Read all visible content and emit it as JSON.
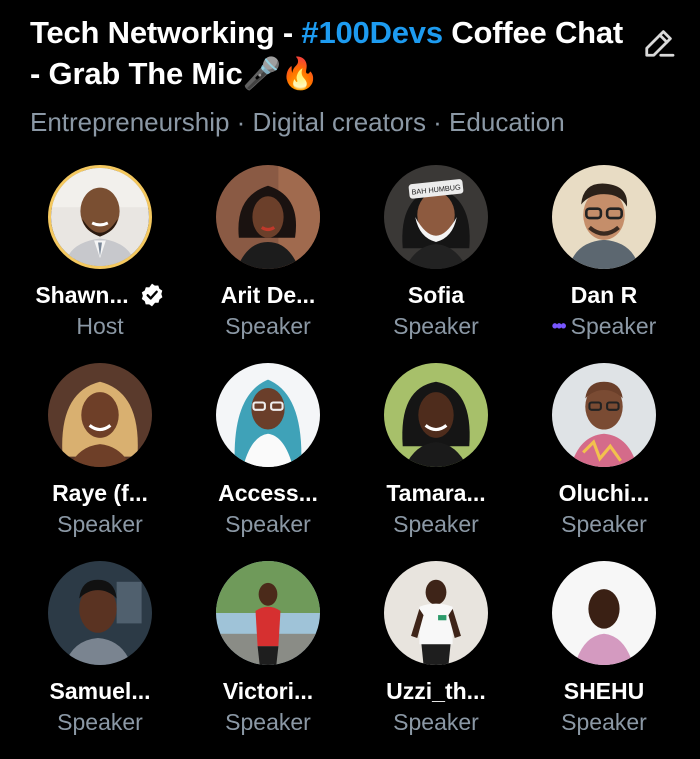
{
  "space": {
    "title_pre": "Tech Networking - ",
    "title_tag": "#100Devs",
    "title_post": " Coffee Chat - Grab The Mic🎤🔥",
    "topics": "Entrepreneurship · Digital creators · Education",
    "accent": "#1d9bf0",
    "host_ring": "#f4c85f"
  },
  "participants": [
    {
      "name": "Shawn...",
      "role": "Host",
      "verified": true,
      "speaking": false
    },
    {
      "name": "Arit De...",
      "role": "Speaker",
      "verified": false,
      "speaking": false
    },
    {
      "name": "Sofia",
      "role": "Speaker",
      "verified": false,
      "speaking": false
    },
    {
      "name": "Dan R",
      "role": "Speaker",
      "verified": false,
      "speaking": true
    },
    {
      "name": "Raye (f...",
      "role": "Speaker",
      "verified": false,
      "speaking": false
    },
    {
      "name": "Access...",
      "role": "Speaker",
      "verified": false,
      "speaking": false
    },
    {
      "name": "Tamara...",
      "role": "Speaker",
      "verified": false,
      "speaking": false
    },
    {
      "name": "Oluchi...",
      "role": "Speaker",
      "verified": false,
      "speaking": false
    },
    {
      "name": "Samuel...",
      "role": "Speaker",
      "verified": false,
      "speaking": false
    },
    {
      "name": "Victori...",
      "role": "Speaker",
      "verified": false,
      "speaking": false
    },
    {
      "name": "Uzzi_th...",
      "role": "Speaker",
      "verified": false,
      "speaking": false
    },
    {
      "name": "SHEHU",
      "role": "Speaker",
      "verified": false,
      "speaking": false
    }
  ],
  "speaking_indicator": "•••"
}
